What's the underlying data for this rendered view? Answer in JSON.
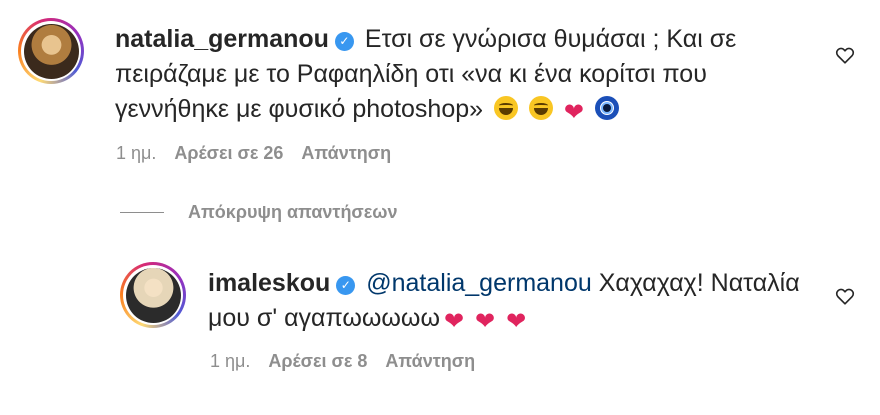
{
  "comments": [
    {
      "username": "natalia_germanou",
      "verified": true,
      "text": "Ετσι σε γνώρισα θυμάσαι ; Και σε πειράζαμε με το Ραφαηλίδη οτι «να κι ένα κορίτσι που γεννήθηκε με φυσικό photoshop»",
      "emojis": [
        "laughing-tears",
        "laughing-tears",
        "red-heart",
        "nazar-amulet"
      ],
      "time": "1 ημ.",
      "likes": "Αρέσει σε 26",
      "reply": "Απάντηση"
    }
  ],
  "hide_replies": "Απόκρυψη απαντήσεων",
  "reply_comment": {
    "username": "imaleskou",
    "verified": true,
    "mention": "@natalia_germanou",
    "text": " Χαχαχαχ! Ναταλία μου σ' αγαπωωωωω",
    "emojis": [
      "red-heart",
      "red-heart",
      "red-heart"
    ],
    "time": "1 ημ.",
    "likes": "Αρέσει σε 8",
    "reply": "Απάντηση"
  },
  "icons": {
    "like": "heart-outline-icon",
    "verified": "verified-badge-icon"
  },
  "colors": {
    "verified": "#3897f0",
    "mention": "#00376b",
    "meta": "#8e8e8e"
  }
}
